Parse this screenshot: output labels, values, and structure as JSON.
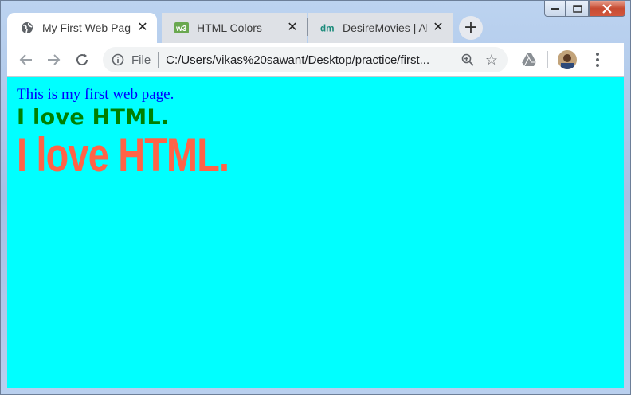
{
  "tabs": [
    {
      "title": "My First Web Page",
      "icon": "globe-icon",
      "active": true
    },
    {
      "title": "HTML Colors",
      "icon": "w3-favicon-icon",
      "active": false
    },
    {
      "title": "DesireMovies | All",
      "icon": "dm-favicon-icon",
      "active": false
    }
  ],
  "toolbar": {
    "scheme_label": "File",
    "url": "C:/Users/vikas%20sawant/Desktop/practice/first..."
  },
  "page": {
    "background_color": "#00ffff",
    "line1": "This is my first web page.",
    "line1_color": "#0000ff",
    "line2": "I love HTML.",
    "line2_color": "#008000",
    "line3": "I love HTML.",
    "line3_color": "#ff6347"
  }
}
